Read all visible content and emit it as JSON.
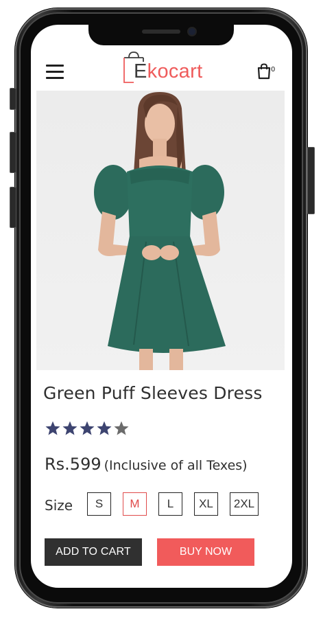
{
  "header": {
    "logo_text_e": "E",
    "logo_text_rest": "kocart",
    "cart_count": "0",
    "menu_icon": "hamburger-menu-icon",
    "cart_icon": "shopping-bag-icon"
  },
  "product": {
    "image_icon": "product-photo",
    "title": "Green Puff Sleeves Dress",
    "rating": 4,
    "rating_max": 5,
    "price": "Rs.599",
    "price_note": "(Inclusive of all Texes)",
    "size_label": "Size",
    "sizes": [
      "S",
      "M",
      "L",
      "XL",
      "2XL"
    ],
    "selected_size": "M"
  },
  "actions": {
    "add_to_cart": "ADD TO CART",
    "buy_now": "BUY NOW"
  },
  "colors": {
    "accent": "#f15b5b",
    "dark_button": "#303030",
    "star_filled": "#3d4470",
    "star_empty": "#6b6b6b",
    "dress_green": "#2c6b5c"
  }
}
